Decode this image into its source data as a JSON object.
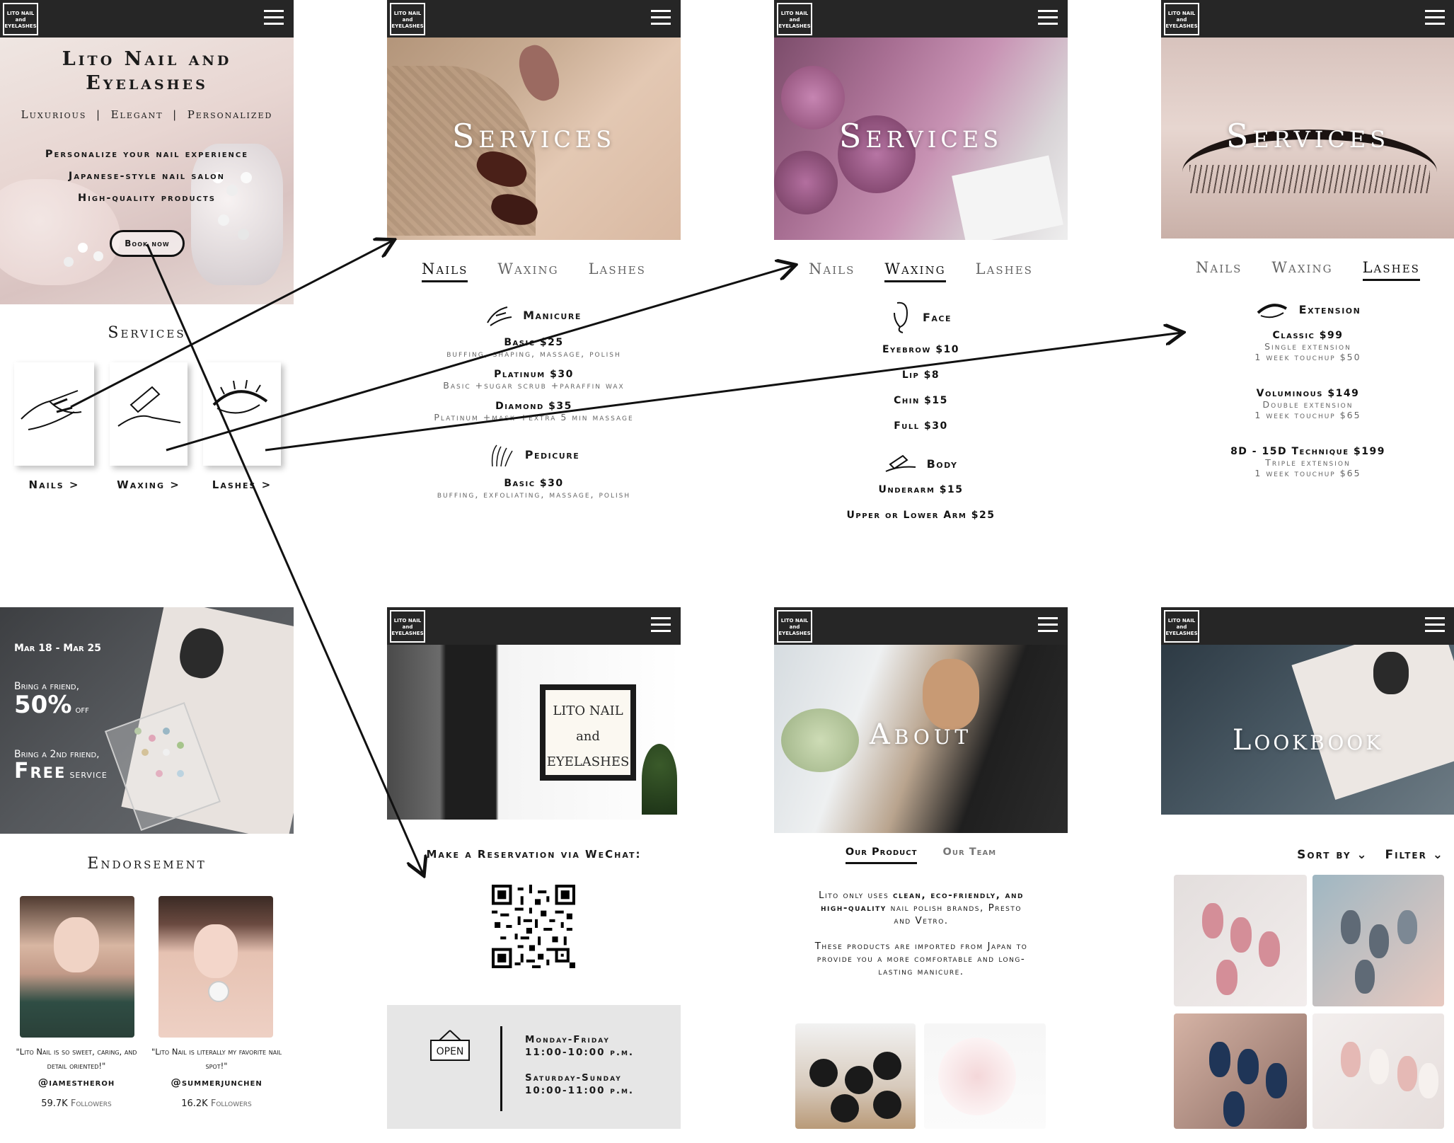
{
  "logo": {
    "line1": "LITO NAIL",
    "line2": "and",
    "line3": "EYELASHES"
  },
  "home": {
    "title_line1": "Lito Nail and",
    "title_line2": "Eyelashes",
    "tagline": [
      "Luxurious",
      "Elegant",
      "Personalized"
    ],
    "features": [
      "Personalize your nail experience",
      "Japanese-style nail salon",
      "High-quality products"
    ],
    "book_button": "Book now",
    "services_heading": "Services",
    "service_cards": [
      "Nails >",
      "Waxing >",
      "Lashes >"
    ]
  },
  "promo": {
    "dates": "Mar 18 - Mar 25",
    "line1": "Bring a friend,",
    "big1": "50%",
    "small1": "off",
    "line2": "Bring a 2nd friend,",
    "big2": "Free",
    "small2": "service"
  },
  "endorsement": {
    "heading": "Endorsement",
    "people": [
      {
        "quote": "\"Lito Nail is so sweet, caring, and detail oriented!\"",
        "handle": "@iamestheroh",
        "followers": "59.7K",
        "followers_label": "Followers"
      },
      {
        "quote": "\"Lito Nail is literally my favorite nail spot!\"",
        "handle": "@summerjunchen",
        "followers": "16.2K",
        "followers_label": "Followers"
      }
    ]
  },
  "services_page": {
    "hero_title": "Services",
    "tabs": [
      "Nails",
      "Waxing",
      "Lashes"
    ]
  },
  "nails": {
    "manicure_heading": "Manicure",
    "manicure": [
      {
        "name": "Basic $25",
        "desc": "buffing, shaping, massage, polish"
      },
      {
        "name": "Platinum $30",
        "desc": "Basic +sugar scrub +paraffin wax"
      },
      {
        "name": "Diamond $35",
        "desc": "Platinum +mask +extra 5 min massage"
      }
    ],
    "pedicure_heading": "Pedicure",
    "pedicure": [
      {
        "name": "Basic $30",
        "desc": "buffing, exfoliating, massage, polish"
      }
    ]
  },
  "waxing": {
    "face_heading": "Face",
    "face": [
      "Eyebrow $10",
      "Lip $8",
      "Chin $15",
      "Full $30"
    ],
    "body_heading": "Body",
    "body": [
      "Underarm $15",
      "Upper or Lower Arm $25"
    ]
  },
  "lashes": {
    "heading": "Extension",
    "items": [
      {
        "name": "Classic $99",
        "desc1": "Single extension",
        "desc2": "1 week touchup $50"
      },
      {
        "name": "Voluminous $149",
        "desc1": "Double extension",
        "desc2": "1 week touchup $65"
      },
      {
        "name": "8D - 15D Technique $199",
        "desc1": "Triple extension",
        "desc2": "1 week touchup $65"
      }
    ]
  },
  "reservation": {
    "sign_line1": "LITO NAIL",
    "sign_line2": "and",
    "sign_line3": "EYELASHES",
    "heading": "Make a Reservation via WeChat:",
    "open_sign": "OPEN",
    "hours1_days": "Monday-Friday",
    "hours1_time": "11:00-10:00 p.m.",
    "hours2_days": "Saturday-Sunday",
    "hours2_time": "10:00-11:00 p.m."
  },
  "about": {
    "hero_title": "About",
    "tabs": [
      "Our Product",
      "Our Team"
    ],
    "para1_a": "Lito only uses ",
    "para1_b": "clean, eco-friendly, and high-quality",
    "para1_c": " nail polish brands, Presto and Vetro.",
    "para2": "These products are imported from Japan to provide you a more comfortable and long-lasting manicure."
  },
  "lookbook": {
    "hero_title": "Lookbook",
    "sort": "Sort by",
    "filter": "Filter"
  },
  "colors": {
    "bar": "#262626",
    "arrow": "#111111",
    "hours_bg": "#e6e6e6"
  }
}
